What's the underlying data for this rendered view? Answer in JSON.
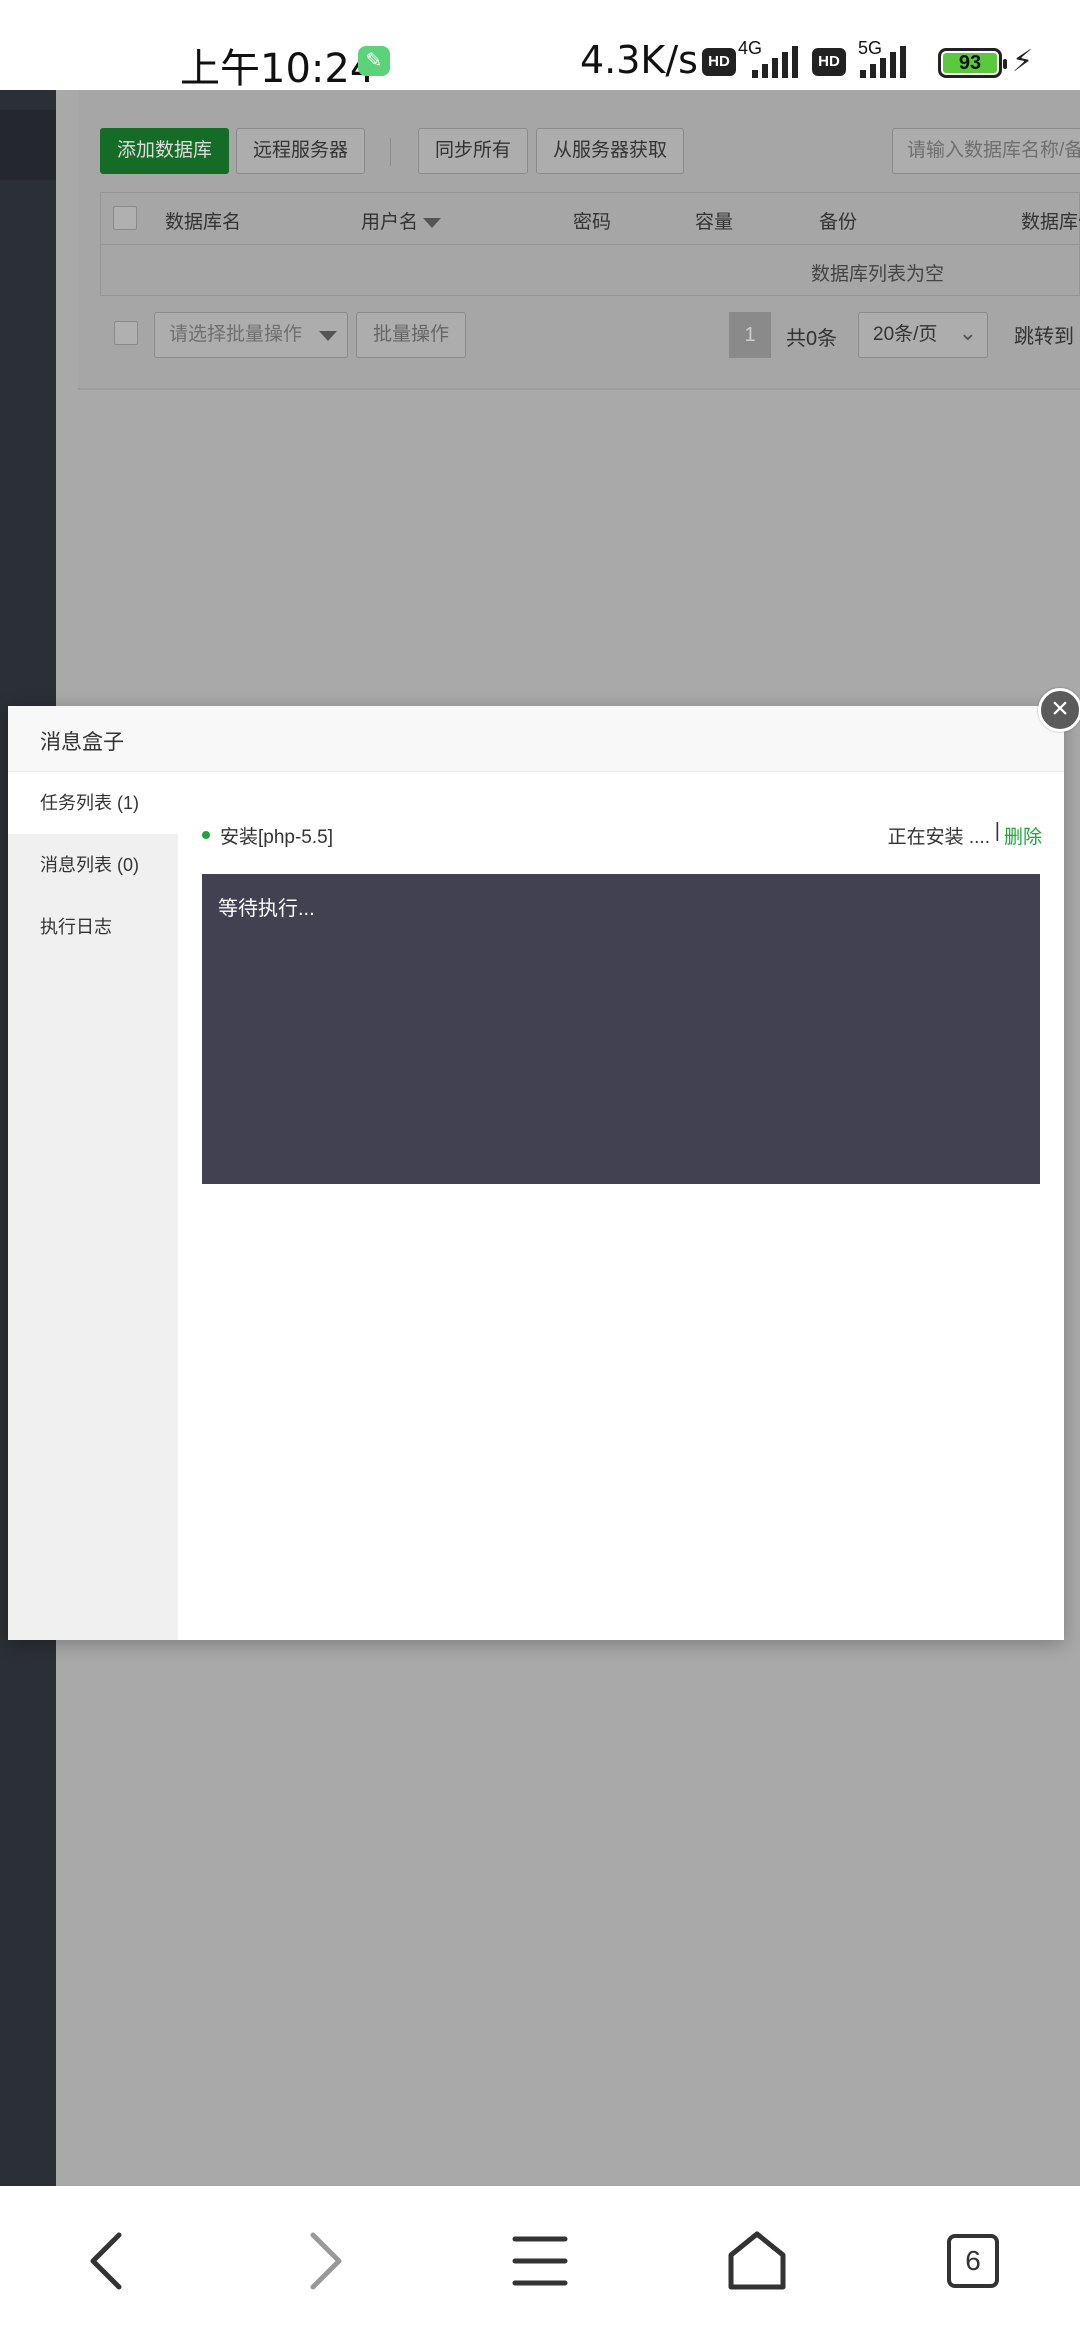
{
  "status_bar": {
    "time": "上午10:24",
    "speed": "4.3K/s",
    "hd_label": "HD",
    "net1": "4G",
    "net2": "5G",
    "battery": "93"
  },
  "background_page": {
    "buttons": {
      "add_db": "添加数据库",
      "remote_server": "远程服务器",
      "sync_all": "同步所有",
      "fetch_from_server": "从服务器获取",
      "batch_op": "批量操作"
    },
    "search_placeholder": "请输入数据库名称/备注",
    "table_headers": [
      "数据库名",
      "用户名",
      "密码",
      "容量",
      "备份",
      "数据库位置"
    ],
    "empty_text": "数据库列表为空",
    "batch_select_placeholder": "请选择批量操作",
    "pagination": {
      "current_page": "1",
      "total": "共0条",
      "per_page": "20条/页",
      "jump_to": "跳转到"
    }
  },
  "modal": {
    "title": "消息盒子",
    "close_icon": "×",
    "sidebar": [
      {
        "label": "任务列表 (1)",
        "active": true
      },
      {
        "label": "消息列表 (0)",
        "active": false
      },
      {
        "label": "执行日志",
        "active": false
      }
    ],
    "task": {
      "name": "安装[php-5.5]",
      "status": "正在安装 ....",
      "separator": "|",
      "delete_label": "删除",
      "console_text": "等待执行..."
    }
  },
  "bottom_nav": {
    "tab_count": "6"
  },
  "colors": {
    "accent_green": "#20a53a",
    "console_bg": "#424151",
    "overlay": "#a9a9a9"
  }
}
